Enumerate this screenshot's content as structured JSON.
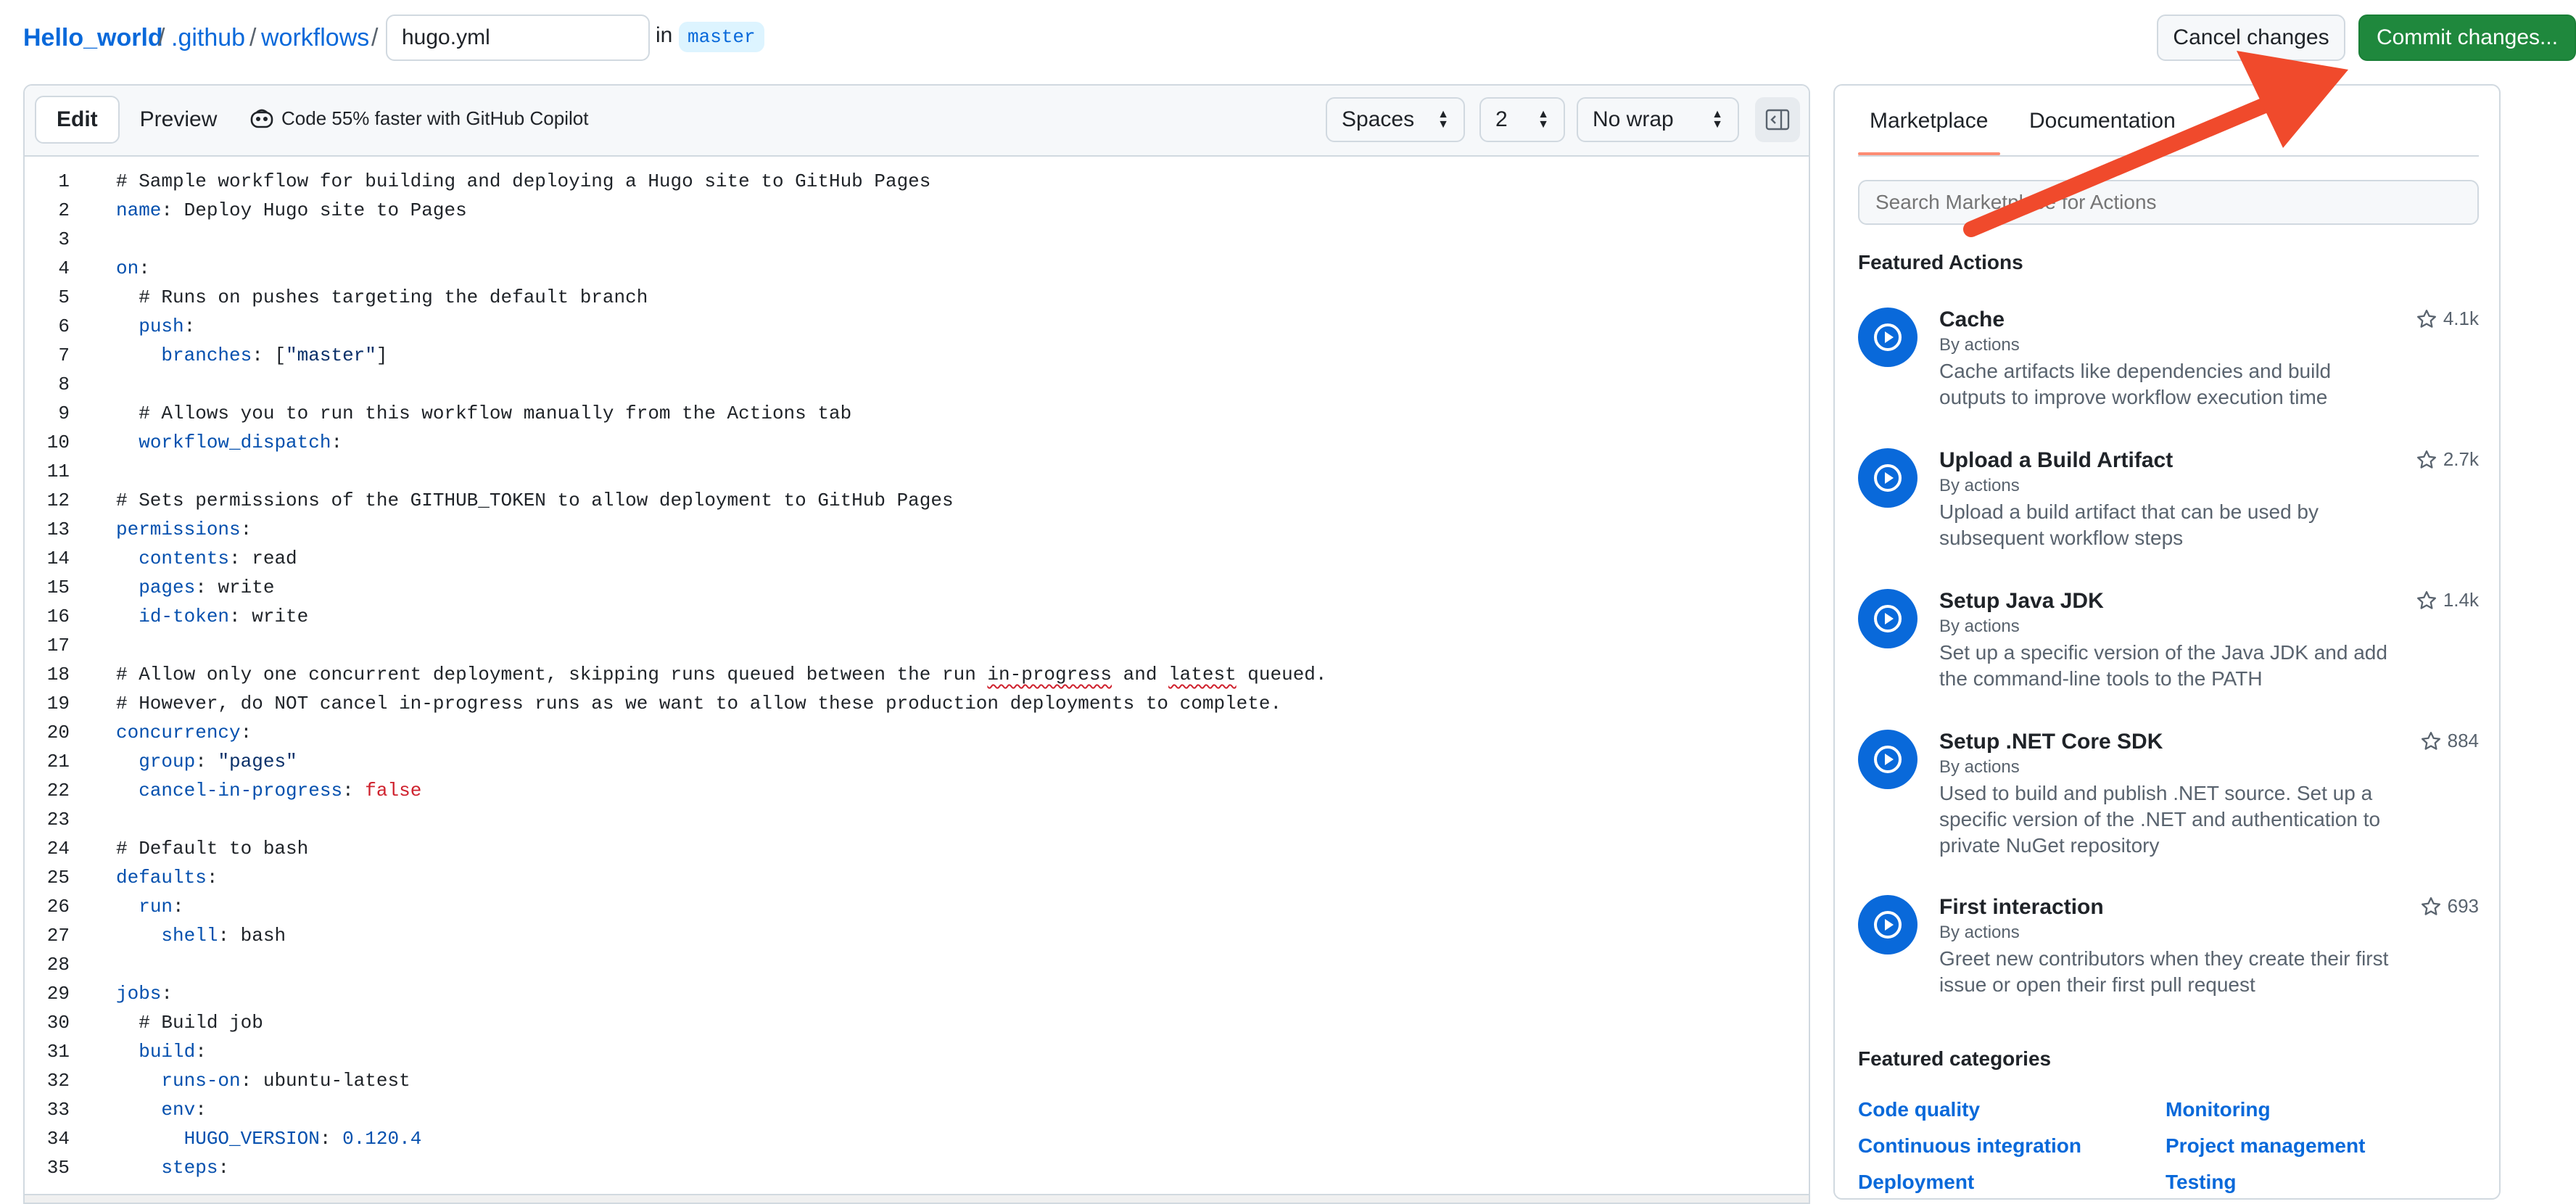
{
  "breadcrumb": {
    "repo": "Hello_world",
    "sep1": "/",
    "dir1": ".github",
    "sep2": "/",
    "dir2": "workflows",
    "sep3": "/",
    "filename": "hugo.yml",
    "in_label": "in",
    "branch": "master"
  },
  "actions": {
    "cancel_label": "Cancel changes",
    "commit_label": "Commit changes..."
  },
  "editor": {
    "edit_tab": "Edit",
    "preview_tab": "Preview",
    "copilot_text": "Code 55% faster with GitHub Copilot",
    "indent_mode": "Spaces",
    "indent_size": "2",
    "wrap_mode": "No wrap",
    "lines": [
      [
        {
          "t": "# Sample workflow for building and deploying a Hugo site to GitHub Pages"
        }
      ],
      [
        {
          "t": "name",
          "c": "k"
        },
        {
          "t": ": Deploy Hugo site to Pages"
        }
      ],
      [],
      [
        {
          "t": "on",
          "c": "k"
        },
        {
          "t": ":"
        }
      ],
      [
        {
          "t": "  # Runs on pushes targeting the default branch"
        }
      ],
      [
        {
          "t": "  "
        },
        {
          "t": "push",
          "c": "k"
        },
        {
          "t": ":"
        }
      ],
      [
        {
          "t": "    "
        },
        {
          "t": "branches",
          "c": "k"
        },
        {
          "t": ": ["
        },
        {
          "t": "\"master\"",
          "c": "str"
        },
        {
          "t": "]"
        }
      ],
      [],
      [
        {
          "t": "  # Allows you to run this workflow manually from the Actions tab"
        }
      ],
      [
        {
          "t": "  "
        },
        {
          "t": "workflow_dispatch",
          "c": "k"
        },
        {
          "t": ":"
        }
      ],
      [],
      [
        {
          "t": "# Sets permissions of the GITHUB_TOKEN to allow deployment to GitHub Pages"
        }
      ],
      [
        {
          "t": "permissions",
          "c": "k"
        },
        {
          "t": ":"
        }
      ],
      [
        {
          "t": "  "
        },
        {
          "t": "contents",
          "c": "k"
        },
        {
          "t": ": read"
        }
      ],
      [
        {
          "t": "  "
        },
        {
          "t": "pages",
          "c": "k"
        },
        {
          "t": ": write"
        }
      ],
      [
        {
          "t": "  "
        },
        {
          "t": "id-token",
          "c": "k"
        },
        {
          "t": ": write"
        }
      ],
      [],
      [
        {
          "t": "# Allow only one concurrent deployment, skipping runs queued between the run "
        },
        {
          "t": "in-progress",
          "c": "sq"
        },
        {
          "t": " and "
        },
        {
          "t": "latest",
          "c": "sq"
        },
        {
          "t": " queued."
        }
      ],
      [
        {
          "t": "# However, do NOT cancel in-progress runs as we want to allow these production deployments to complete."
        }
      ],
      [
        {
          "t": "concurrency",
          "c": "k"
        },
        {
          "t": ":"
        }
      ],
      [
        {
          "t": "  "
        },
        {
          "t": "group",
          "c": "k"
        },
        {
          "t": ": "
        },
        {
          "t": "\"pages\"",
          "c": "str"
        }
      ],
      [
        {
          "t": "  "
        },
        {
          "t": "cancel-in-progress",
          "c": "k"
        },
        {
          "t": ": "
        },
        {
          "t": "false",
          "c": "bool"
        }
      ],
      [],
      [
        {
          "t": "# Default to bash"
        }
      ],
      [
        {
          "t": "defaults",
          "c": "k"
        },
        {
          "t": ":"
        }
      ],
      [
        {
          "t": "  "
        },
        {
          "t": "run",
          "c": "k"
        },
        {
          "t": ":"
        }
      ],
      [
        {
          "t": "    "
        },
        {
          "t": "shell",
          "c": "k"
        },
        {
          "t": ": bash"
        }
      ],
      [],
      [
        {
          "t": "jobs",
          "c": "k"
        },
        {
          "t": ":"
        }
      ],
      [
        {
          "t": "  # Build job"
        }
      ],
      [
        {
          "t": "  "
        },
        {
          "t": "build",
          "c": "k"
        },
        {
          "t": ":"
        }
      ],
      [
        {
          "t": "    "
        },
        {
          "t": "runs-on",
          "c": "k"
        },
        {
          "t": ": ubuntu-latest"
        }
      ],
      [
        {
          "t": "    "
        },
        {
          "t": "env",
          "c": "k"
        },
        {
          "t": ":"
        }
      ],
      [
        {
          "t": "      "
        },
        {
          "t": "HUGO_VERSION",
          "c": "k"
        },
        {
          "t": ": "
        },
        {
          "t": "0.120.4",
          "c": "num"
        }
      ],
      [
        {
          "t": "    "
        },
        {
          "t": "steps",
          "c": "k"
        },
        {
          "t": ":"
        }
      ]
    ]
  },
  "sidebar": {
    "tab_marketplace": "Marketplace",
    "tab_documentation": "Documentation",
    "search_placeholder": "Search Marketplace for Actions",
    "featured_title": "Featured Actions",
    "featured": [
      {
        "name": "Cache",
        "by": "By actions",
        "desc": "Cache artifacts like dependencies and build outputs to improve workflow execution time",
        "stars": "4.1k"
      },
      {
        "name": "Upload a Build Artifact",
        "by": "By actions",
        "desc": "Upload a build artifact that can be used by subsequent workflow steps",
        "stars": "2.7k"
      },
      {
        "name": "Setup Java JDK",
        "by": "By actions",
        "desc": "Set up a specific version of the Java JDK and add the command-line tools to the PATH",
        "stars": "1.4k"
      },
      {
        "name": "Setup .NET Core SDK",
        "by": "By actions",
        "desc": "Used to build and publish .NET source. Set up a specific version of the .NET and authentication to private NuGet repository",
        "stars": "884"
      },
      {
        "name": "First interaction",
        "by": "By actions",
        "desc": "Greet new contributors when they create their first issue or open their first pull request",
        "stars": "693"
      }
    ],
    "categories_title": "Featured categories",
    "categories": [
      "Code quality",
      "Monitoring",
      "Continuous integration",
      "Project management",
      "Deployment",
      "Testing"
    ]
  },
  "colors": {
    "accent": "#0969da",
    "commit_green": "#1f883d",
    "annotation_arrow": "#f04a2c"
  }
}
